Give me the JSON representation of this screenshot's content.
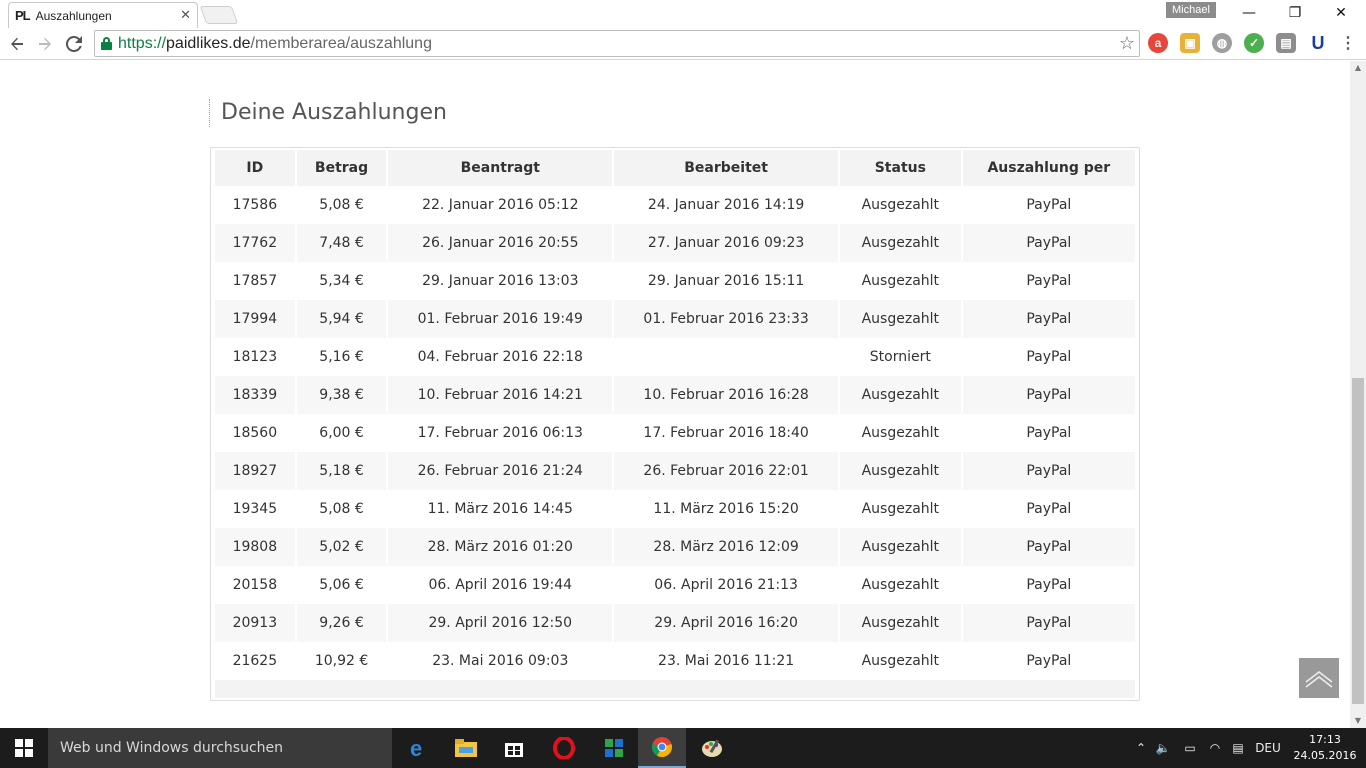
{
  "browser": {
    "tab_title": "Auszahlungen",
    "tab_favicon": "PL",
    "user": "Michael",
    "url_scheme": "https://",
    "url_host": "paidlikes.de",
    "url_path": "/memberarea/auszahlung"
  },
  "page": {
    "heading": "Deine Auszahlungen",
    "columns": [
      "ID",
      "Betrag",
      "Beantragt",
      "Bearbeitet",
      "Status",
      "Auszahlung per"
    ],
    "rows": [
      [
        "17586",
        "5,08 €",
        "22. Januar 2016 05:12",
        "24. Januar 2016 14:19",
        "Ausgezahlt",
        "PayPal"
      ],
      [
        "17762",
        "7,48 €",
        "26. Januar 2016 20:55",
        "27. Januar 2016 09:23",
        "Ausgezahlt",
        "PayPal"
      ],
      [
        "17857",
        "5,34 €",
        "29. Januar 2016 13:03",
        "29. Januar 2016 15:11",
        "Ausgezahlt",
        "PayPal"
      ],
      [
        "17994",
        "5,94 €",
        "01. Februar 2016 19:49",
        "01. Februar 2016 23:33",
        "Ausgezahlt",
        "PayPal"
      ],
      [
        "18123",
        "5,16 €",
        "04. Februar 2016 22:18",
        "",
        "Storniert",
        "PayPal"
      ],
      [
        "18339",
        "9,38 €",
        "10. Februar 2016 14:21",
        "10. Februar 2016 16:28",
        "Ausgezahlt",
        "PayPal"
      ],
      [
        "18560",
        "6,00 €",
        "17. Februar 2016 06:13",
        "17. Februar 2016 18:40",
        "Ausgezahlt",
        "PayPal"
      ],
      [
        "18927",
        "5,18 €",
        "26. Februar 2016 21:24",
        "26. Februar 2016 22:01",
        "Ausgezahlt",
        "PayPal"
      ],
      [
        "19345",
        "5,08 €",
        "11. März 2016 14:45",
        "11. März 2016 15:20",
        "Ausgezahlt",
        "PayPal"
      ],
      [
        "19808",
        "5,02 €",
        "28. März 2016 01:20",
        "28. März 2016 12:09",
        "Ausgezahlt",
        "PayPal"
      ],
      [
        "20158",
        "5,06 €",
        "06. April 2016 19:44",
        "06. April 2016 21:13",
        "Ausgezahlt",
        "PayPal"
      ],
      [
        "20913",
        "9,26 €",
        "29. April 2016 12:50",
        "29. April 2016 16:20",
        "Ausgezahlt",
        "PayPal"
      ],
      [
        "21625",
        "10,92 €",
        "23. Mai 2016 09:03",
        "23. Mai 2016 11:21",
        "Ausgezahlt",
        "PayPal"
      ]
    ]
  },
  "taskbar": {
    "search_placeholder": "Web und Windows durchsuchen",
    "language": "DEU",
    "time": "17:13",
    "date": "24.05.2016"
  },
  "icons": {
    "back": "back-arrow-icon",
    "forward": "forward-arrow-icon",
    "reload": "reload-icon",
    "bookmark": "star-icon",
    "menu": "menu-icon"
  },
  "colors": {
    "secure_green": "#0b8043",
    "taskbar_bg": "#1c1c1c",
    "header_bg": "#f3f3f3",
    "alt_row_bg": "#f7f7f7"
  }
}
